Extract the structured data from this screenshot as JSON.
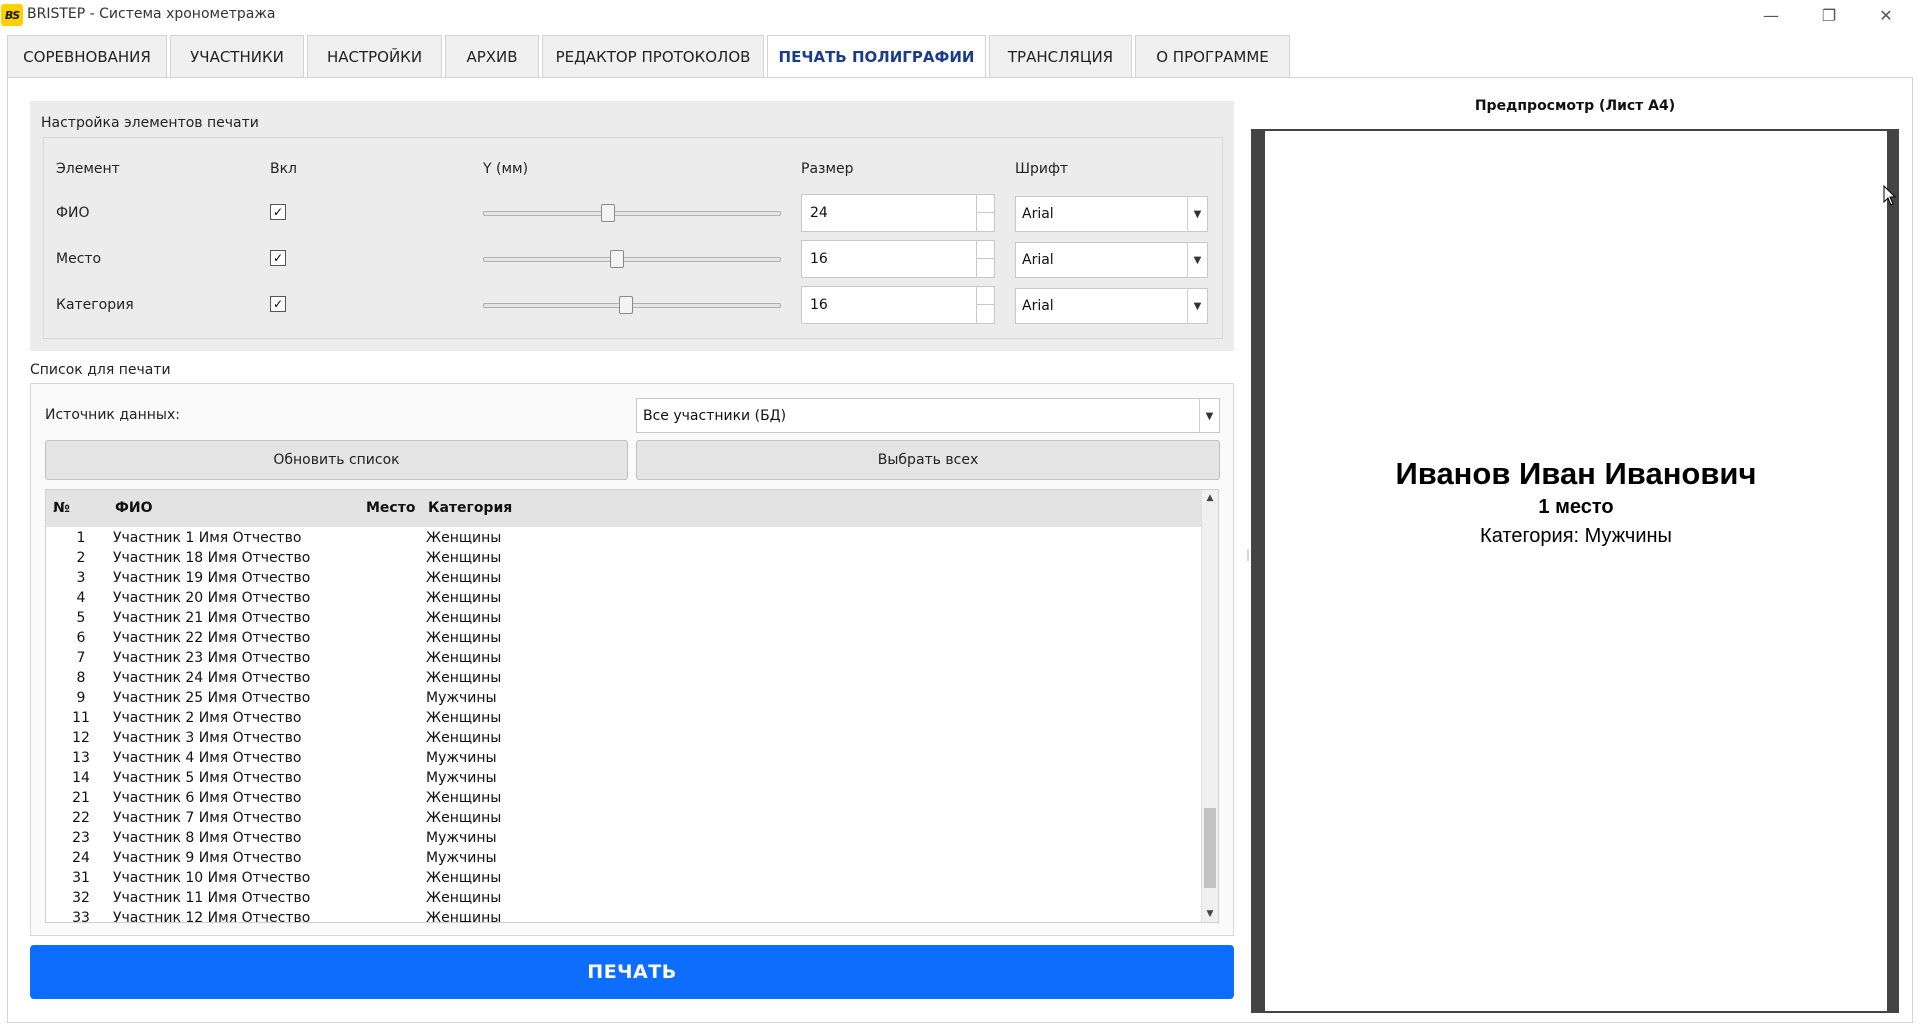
{
  "window": {
    "logo_text": "BS",
    "title": "BRISTEP - Система хронометража",
    "controls": [
      "—",
      "❐",
      "✕"
    ]
  },
  "tabs": [
    {
      "label": "СОРЕВНОВАНИЯ"
    },
    {
      "label": "УЧАСТНИКИ"
    },
    {
      "label": "НАСТРОЙКИ"
    },
    {
      "label": "АРХИВ"
    },
    {
      "label": "РЕДАКТОР ПРОТОКОЛОВ"
    },
    {
      "label": "ПЕЧАТЬ ПОЛИГРАФИИ",
      "active": true
    },
    {
      "label": "ТРАНСЛЯЦИЯ"
    },
    {
      "label": "О ПРОГРАММЕ"
    }
  ],
  "print_settings": {
    "title": "Настройка элементов печати",
    "columns": {
      "element": "Элемент",
      "enabled": "Вкл",
      "y": "Y (мм)",
      "size": "Размер",
      "font": "Шрифт"
    },
    "rows": [
      {
        "label": "ФИО",
        "enabled": true,
        "check": "✓",
        "y_fraction": 0.42,
        "size": "24",
        "font": "Arial"
      },
      {
        "label": "Место",
        "enabled": true,
        "check": "✓",
        "y_fraction": 0.45,
        "size": "16",
        "font": "Arial"
      },
      {
        "label": "Категория",
        "enabled": true,
        "check": "✓",
        "y_fraction": 0.48,
        "size": "16",
        "font": "Arial"
      }
    ]
  },
  "print_list": {
    "title": "Список для печати",
    "source_label": "Источник данных:",
    "source_value": "Все участники (БД)",
    "refresh_button": "Обновить список",
    "select_all_button": "Выбрать всех",
    "columns": {
      "num": "№",
      "name": "ФИО",
      "place": "Место",
      "category": "Категория"
    },
    "rows": [
      {
        "num": "1",
        "name": "Участник 1 Имя Отчество",
        "place": "",
        "category": "Женщины"
      },
      {
        "num": "2",
        "name": "Участник 18 Имя Отчество",
        "place": "",
        "category": "Женщины"
      },
      {
        "num": "3",
        "name": "Участник 19 Имя Отчество",
        "place": "",
        "category": "Женщины"
      },
      {
        "num": "4",
        "name": "Участник 20 Имя Отчество",
        "place": "",
        "category": "Женщины"
      },
      {
        "num": "5",
        "name": "Участник 21 Имя Отчество",
        "place": "",
        "category": "Женщины"
      },
      {
        "num": "6",
        "name": "Участник 22 Имя Отчество",
        "place": "",
        "category": "Женщины"
      },
      {
        "num": "7",
        "name": "Участник 23 Имя Отчество",
        "place": "",
        "category": "Женщины"
      },
      {
        "num": "8",
        "name": "Участник 24 Имя Отчество",
        "place": "",
        "category": "Женщины"
      },
      {
        "num": "9",
        "name": "Участник 25 Имя Отчество",
        "place": "",
        "category": "Мужчины"
      },
      {
        "num": "11",
        "name": "Участник 2 Имя Отчество",
        "place": "",
        "category": "Женщины"
      },
      {
        "num": "12",
        "name": "Участник 3 Имя Отчество",
        "place": "",
        "category": "Женщины"
      },
      {
        "num": "13",
        "name": "Участник 4 Имя Отчество",
        "place": "",
        "category": "Мужчины"
      },
      {
        "num": "14",
        "name": "Участник 5 Имя Отчество",
        "place": "",
        "category": "Мужчины"
      },
      {
        "num": "21",
        "name": "Участник 6 Имя Отчество",
        "place": "",
        "category": "Женщины"
      },
      {
        "num": "22",
        "name": "Участник 7 Имя Отчество",
        "place": "",
        "category": "Женщины"
      },
      {
        "num": "23",
        "name": "Участник 8 Имя Отчество",
        "place": "",
        "category": "Мужчины"
      },
      {
        "num": "24",
        "name": "Участник 9 Имя Отчество",
        "place": "",
        "category": "Мужчины"
      },
      {
        "num": "31",
        "name": "Участник 10 Имя Отчество",
        "place": "",
        "category": "Женщины"
      },
      {
        "num": "32",
        "name": "Участник 11 Имя Отчество",
        "place": "",
        "category": "Женщины"
      },
      {
        "num": "33",
        "name": "Участник 12 Имя Отчество",
        "place": "",
        "category": "Женщины"
      }
    ]
  },
  "print_button": "ПЕЧАТЬ",
  "preview": {
    "title": "Предпросмотр (Лист А4)",
    "name": "Иванов Иван Иванович",
    "place": "1 место",
    "category": "Категория: Мужчины"
  },
  "colors": {
    "accent": "#0d6efd",
    "active_tab_text": "#1b3c8a",
    "logo": "#ffd000"
  }
}
